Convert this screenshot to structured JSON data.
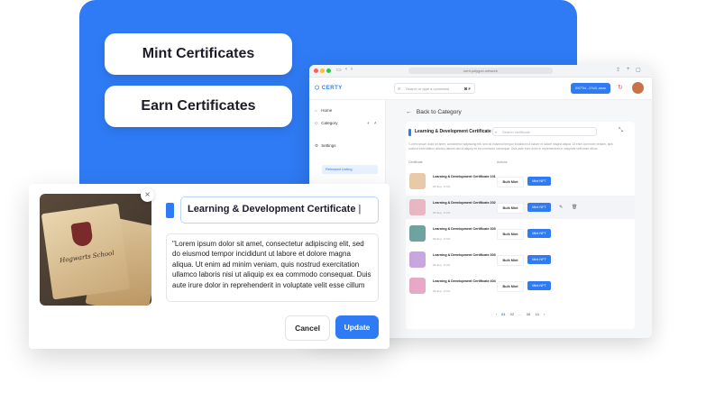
{
  "hero": {
    "mint_label": "Mint Certificates",
    "earn_label": "Earn Certificates"
  },
  "browser": {
    "url": "certi.polygon.network"
  },
  "app": {
    "logo": "CERTY",
    "search_placeholder": "Search or type a command",
    "search_shortcut": "⌘ F",
    "wallet_label": "0X77d...17c3..near",
    "sidebar": {
      "home": "Home",
      "category": "Category",
      "released_listing": "Released Listing",
      "settings": "Settings"
    },
    "back_label": "Back to Category",
    "card": {
      "title": "Learning & Development Certificate",
      "search_placeholder": "Search certificate",
      "description": "\"Lorem ipsum dolor sit amet, consectetur adipiscing elit, sed do eiusmod tempor incididunt ut labore et dolore magna aliqua. Ut enim ad minim veniam, quis nostrud exercitation ullamco laboris nisi ut aliquip ex ea commodo consequat. Duis aute irure dolor in reprehenderit in voluptate velit esse cillum",
      "col_certificate": "Certificate",
      "col_actions": "Actions",
      "bulk_label": "Bulk Mint",
      "mint_label": "Mint NFT",
      "rows": [
        {
          "title": "Learning & Development Certificate 101",
          "date": "29 Sep - 9 Oct",
          "color": "#e8c9a8"
        },
        {
          "title": "Learning & Development Certificate 202",
          "date": "29 Sep - 9 Oct",
          "color": "#e9b7c3"
        },
        {
          "title": "Learning & Development Certificate 303",
          "date": "29 Sep - 9 Oct",
          "color": "#6fa3a0"
        },
        {
          "title": "Learning & Development Certificate 303",
          "date": "29 Sep - 9 Oct",
          "color": "#c9a6e0"
        },
        {
          "title": "Learning & Development Certificate 404",
          "date": "29 Sep - 9 Oct",
          "color": "#e8a9c6"
        }
      ],
      "pager": {
        "prev": "‹",
        "p1": "01",
        "p2": "02",
        "dots": "...",
        "p9": "08",
        "p10": "10",
        "next": "›"
      }
    }
  },
  "modal": {
    "parchment_text": "Hogwarts School",
    "title_value": "Learning & Development Certificate",
    "description": "\"Lorem ipsum dolor sit amet, consectetur adipiscing elit, sed do eiusmod tempor incididunt ut labore et dolore magna aliqua. Ut enim ad minim veniam, quis nostrud exercitation ullamco laboris nisi ut aliquip ex ea commodo consequat. Duis aute irure dolor in reprehenderit in voluptate velit esse cillum",
    "cancel_label": "Cancel",
    "update_label": "Update"
  },
  "colors": {
    "accent": "#2f7bf5"
  }
}
